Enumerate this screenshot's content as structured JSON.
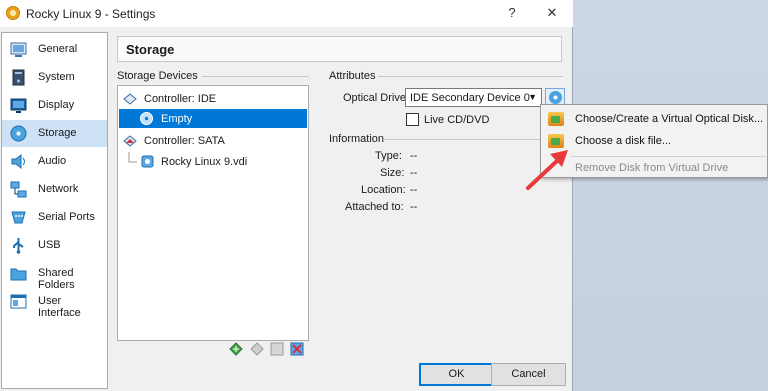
{
  "window": {
    "title": "Rocky Linux 9 - Settings",
    "help_glyph": "?",
    "close_glyph": "✕"
  },
  "sidebar": {
    "items": [
      {
        "label": "General",
        "icon": "general-icon"
      },
      {
        "label": "System",
        "icon": "system-icon"
      },
      {
        "label": "Display",
        "icon": "display-icon"
      },
      {
        "label": "Storage",
        "icon": "storage-icon",
        "selected": true
      },
      {
        "label": "Audio",
        "icon": "audio-icon"
      },
      {
        "label": "Network",
        "icon": "network-icon"
      },
      {
        "label": "Serial Ports",
        "icon": "serial-ports-icon"
      },
      {
        "label": "USB",
        "icon": "usb-icon"
      },
      {
        "label": "Shared Folders",
        "icon": "shared-folders-icon"
      },
      {
        "label": "User Interface",
        "icon": "user-interface-icon"
      }
    ]
  },
  "main": {
    "section_title": "Storage",
    "storage_devices_label": "Storage Devices",
    "tree": {
      "controller_ide": "Controller: IDE",
      "ide_child": "Empty",
      "controller_sata": "Controller: SATA",
      "sata_child": "Rocky Linux 9.vdi"
    },
    "attributes": {
      "label": "Attributes",
      "optical_drive_label": "Optical Drive:",
      "optical_drive_value": "IDE Secondary Device 0",
      "live_cd_label": "Live CD/DVD",
      "live_cd_checked": false
    },
    "information": {
      "label": "Information",
      "type_label": "Type:",
      "type_value": "--",
      "size_label": "Size:",
      "size_value": "--",
      "location_label": "Location:",
      "location_value": "--",
      "attached_label": "Attached to:",
      "attached_value": "--"
    }
  },
  "popup_menu": {
    "items": [
      {
        "label": "Choose/Create a Virtual Optical Disk...",
        "enabled": true
      },
      {
        "label": "Choose a disk file...",
        "enabled": true
      },
      {
        "label": "Remove Disk from Virtual Drive",
        "enabled": false
      }
    ]
  },
  "buttons": {
    "ok": "OK",
    "cancel": "Cancel"
  },
  "colors": {
    "selection": "#0078d7",
    "sidebar_selection": "#cde3f5",
    "annotation_arrow": "#e8393c"
  }
}
